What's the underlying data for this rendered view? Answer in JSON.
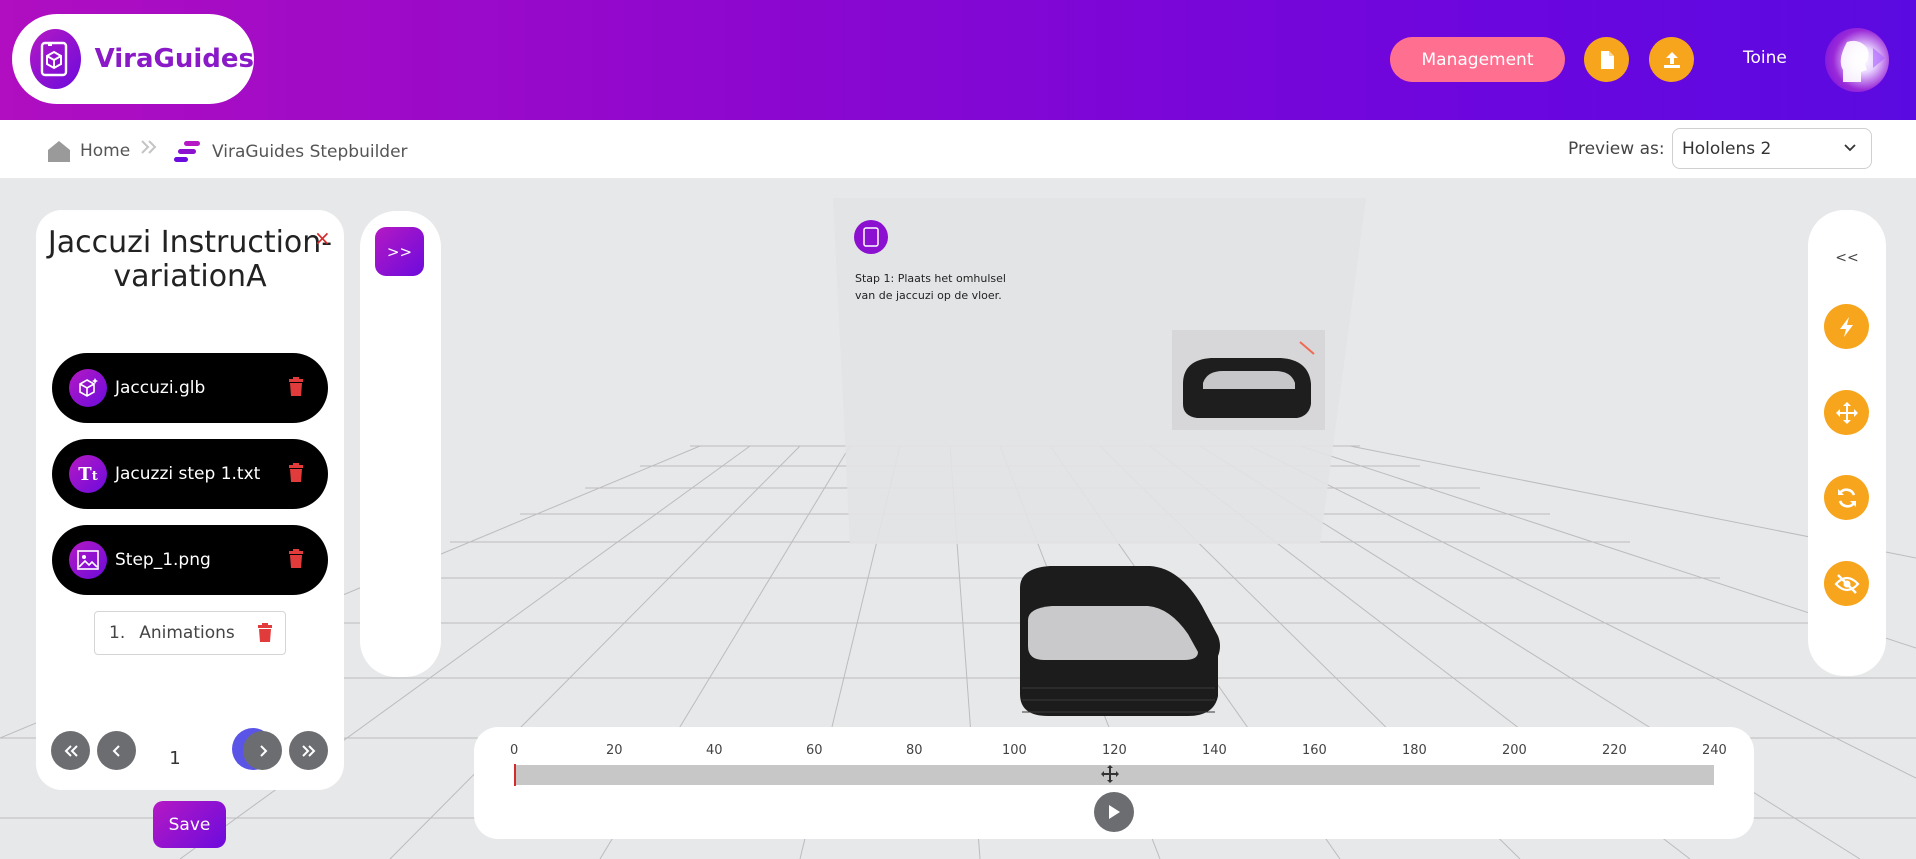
{
  "header": {
    "app_name": "ViraGuides",
    "management_label": "Management",
    "user_name": "Toine"
  },
  "breadcrumb": {
    "home": "Home",
    "current": "ViraGuides Stepbuilder"
  },
  "preview": {
    "label": "Preview as:",
    "selected": "Hololens 2"
  },
  "left_panel": {
    "title": "Jaccuzi Instruction-variationA",
    "close": "×",
    "assets": [
      {
        "label": "Jaccuzi.glb",
        "icon": "cube-sparkle-icon"
      },
      {
        "label": "Jacuzzi step 1.txt",
        "icon": "text-icon"
      },
      {
        "label": "Step_1.png",
        "icon": "image-icon"
      }
    ],
    "animation_index": "1.",
    "animation_label": "Animations",
    "page": "1",
    "add": "+",
    "save_label": "Save"
  },
  "middle": {
    "expand_label": ">>"
  },
  "right_toolbar": {
    "collapse_label": "<<",
    "tools": [
      "flash-icon",
      "move-icon",
      "rotate-icon",
      "visibility-off-icon"
    ]
  },
  "scene": {
    "panel_text": "Stap 1: Plaats het omhulsel van de jaccuzi op de vloer."
  },
  "timeline": {
    "ticks": [
      "0",
      "20",
      "40",
      "60",
      "80",
      "100",
      "120",
      "140",
      "160",
      "180",
      "200",
      "220",
      "240"
    ],
    "playhead_value": 0,
    "max": 240
  },
  "colors": {
    "brand_purple": "#8a1ac8",
    "management_pink": "#ff6f8f",
    "accent_orange": "#f7a51c",
    "danger_red": "#d42b2b",
    "add_blue": "#5a55e6"
  }
}
